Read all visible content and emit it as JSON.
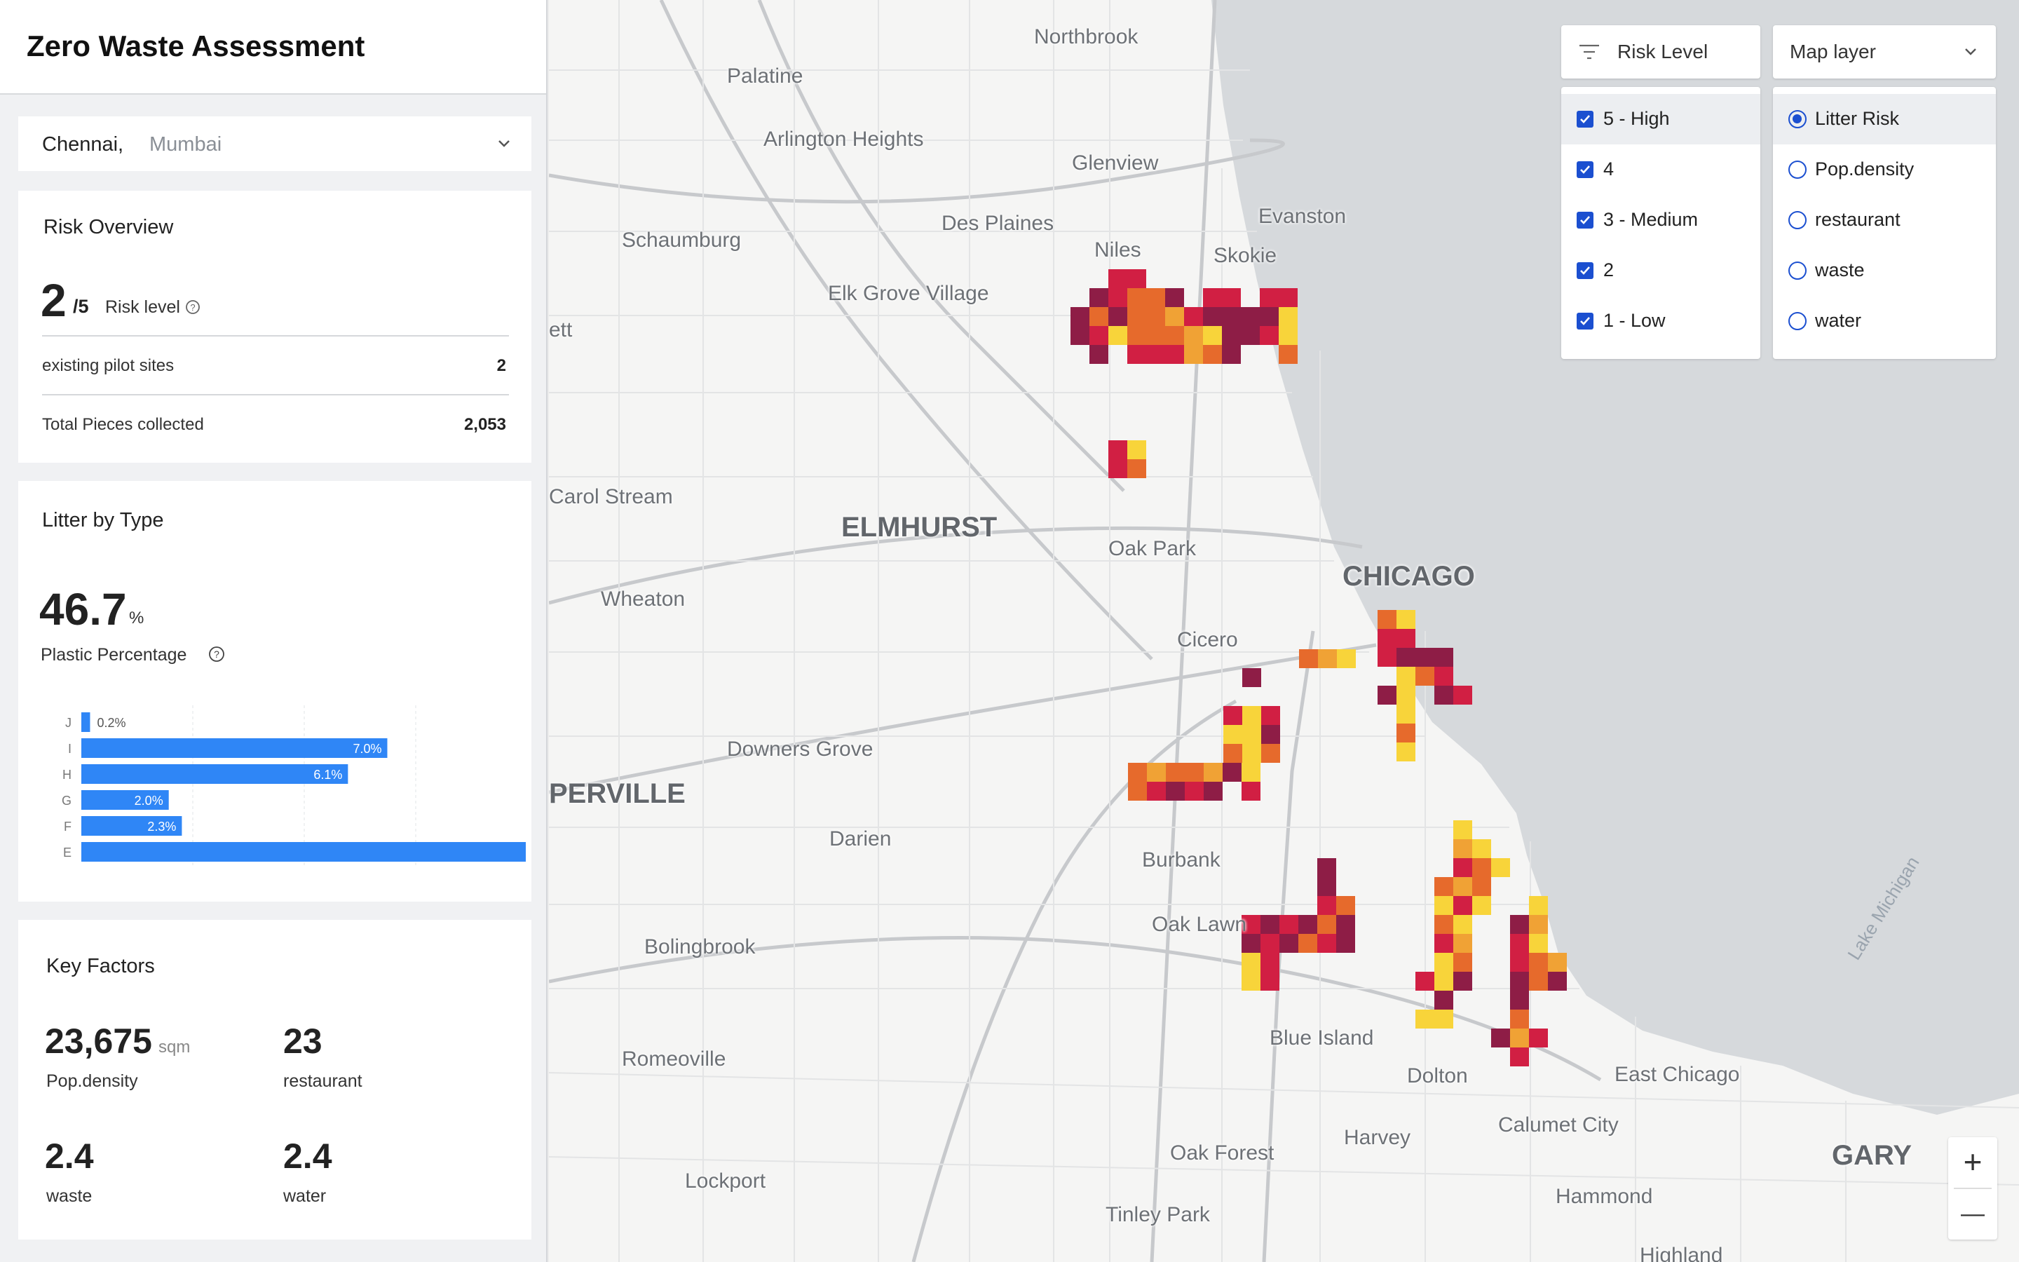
{
  "app": {
    "title": "Zero Waste Assessment"
  },
  "city_select": {
    "primary": "Chennai,",
    "secondary": "Mumbai"
  },
  "risk_overview": {
    "title": "Risk Overview",
    "value": "2",
    "max": "/5",
    "label": "Risk level",
    "stats": [
      {
        "label": "existing pilot sites",
        "value": "2"
      },
      {
        "label": "Total Pieces collected",
        "value": "2,053"
      }
    ]
  },
  "litter": {
    "title": "Litter by Type",
    "value": "46.7",
    "unit": "%",
    "label": "Plastic Percentage"
  },
  "chart_data": {
    "type": "bar",
    "orientation": "horizontal",
    "categories": [
      "J",
      "I",
      "H",
      "G",
      "F",
      "E"
    ],
    "values": [
      0.2,
      7.0,
      6.1,
      2.0,
      2.3,
      10.2
    ],
    "data_labels": [
      "0.2%",
      "7.0%",
      "6.1%",
      "2.0%",
      "2.3%",
      ""
    ],
    "xlim": [
      0,
      10.2
    ],
    "color": "#2f86f6",
    "grid": true
  },
  "key_factors": {
    "title": "Key Factors",
    "items": [
      {
        "value": "23,675",
        "unit": "sqm",
        "label": "Pop.density"
      },
      {
        "value": "23",
        "unit": "",
        "label": "restaurant"
      },
      {
        "value": "2.4",
        "unit": "",
        "label": "waste"
      },
      {
        "value": "2.4",
        "unit": "",
        "label": "water"
      }
    ]
  },
  "map": {
    "places": [
      "Northbrook",
      "Palatine",
      "Arlington Heights",
      "Glenview",
      "Des Plaines",
      "Evanston",
      "Schaumburg",
      "Niles",
      "Skokie",
      "Elk Grove Village",
      "ett",
      "Carol Stream",
      "ELMHURST",
      "Oak Park",
      "CHICAGO",
      "Wheaton",
      "Cicero",
      "Downers Grove",
      "PERVILLE",
      "Darien",
      "Burbank",
      "Oak Lawn",
      "Bolingbrook",
      "Blue Island",
      "Romeoville",
      "Dolton",
      "East Chicago",
      "Calumet City",
      "Harvey",
      "Oak Forest",
      "GARY",
      "Lockport",
      "Tinley Park",
      "Hammond",
      "Highland"
    ],
    "lake_label": "Lake Michigan",
    "risk_colors": {
      "5": "#8e1d46",
      "4": "#d11f43",
      "3": "#e66a2c",
      "2": "#f0a235",
      "1": "#f8d43a"
    },
    "water_color": "#d6d9dc"
  },
  "risk_filter": {
    "label": "Risk Level",
    "options": [
      {
        "label": "5 - High",
        "checked": true
      },
      {
        "label": "4",
        "checked": true
      },
      {
        "label": "3 - Medium",
        "checked": true
      },
      {
        "label": "2",
        "checked": true
      },
      {
        "label": "1 - Low",
        "checked": true
      }
    ]
  },
  "map_layer": {
    "label": "Map layer",
    "options": [
      {
        "label": "Litter Risk",
        "selected": true
      },
      {
        "label": "Pop.density",
        "selected": false
      },
      {
        "label": "restaurant",
        "selected": false
      },
      {
        "label": "waste",
        "selected": false
      },
      {
        "label": "water",
        "selected": false
      }
    ]
  },
  "zoom": {
    "in": "+",
    "out": "—"
  }
}
